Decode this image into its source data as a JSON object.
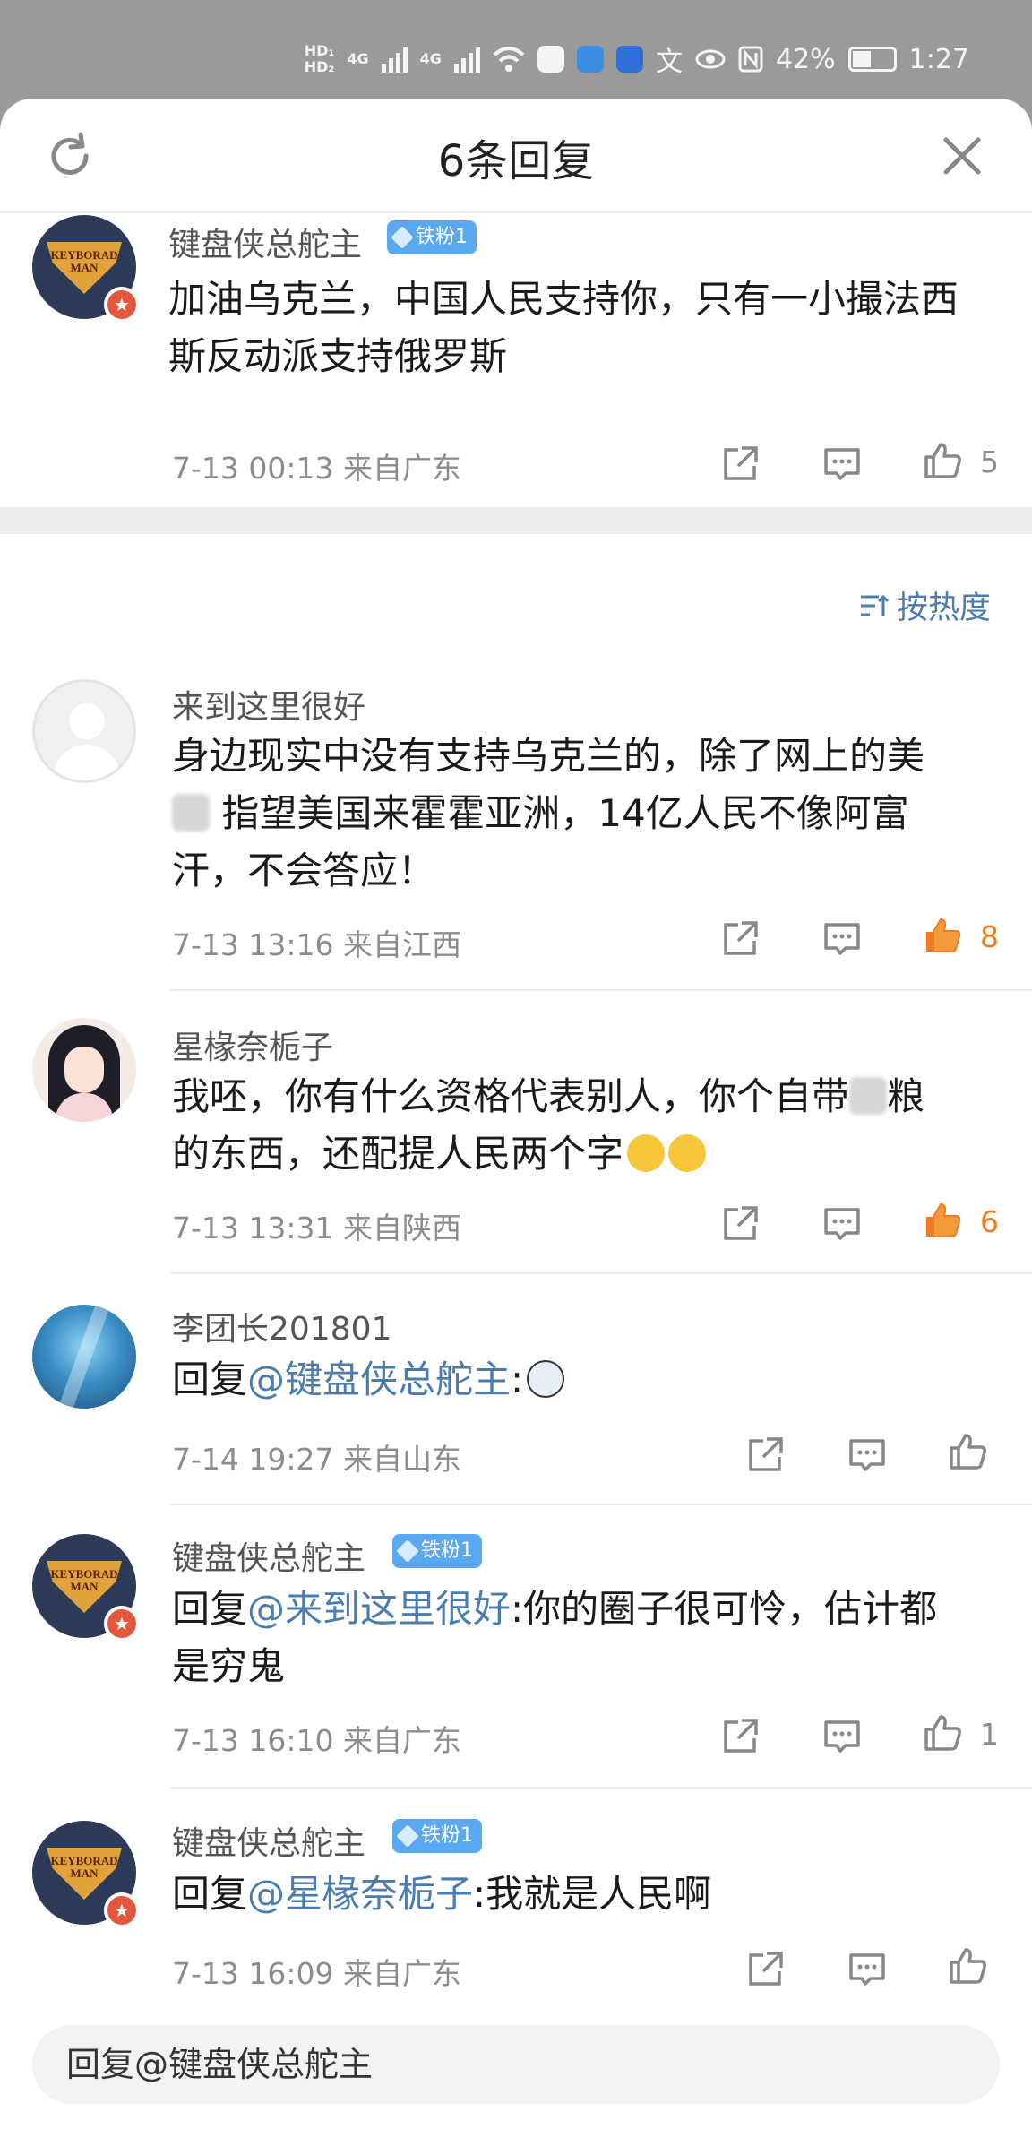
{
  "status_bar": {
    "hd1": "HD₁",
    "hd2": "HD₂",
    "net1": "4G",
    "net2": "4G",
    "battery": "42%",
    "time": "1:27"
  },
  "header": {
    "title": "6条回复"
  },
  "main_comment": {
    "user": "键盘侠总舵主",
    "badge": "铁粉1",
    "text": "加油乌克兰，中国人民支持你，只有一小撮法西斯反动派支持俄罗斯",
    "meta": "7-13 00:13 来自广东",
    "likes": "5"
  },
  "sort": {
    "label": "按热度"
  },
  "replies": [
    {
      "user": "来到这里很好",
      "text_line1": "身边现实中没有支持乌克兰的，除了网上的美",
      "text_line2": " 指望美国来霍霍亚洲，14亿人民不像阿富",
      "text_line3": "汗，不会答应！",
      "meta": "7-13 13:16 来自江西",
      "likes": "8"
    },
    {
      "user": "星椽奈栀子",
      "text_line1a": "我呸，你有什么资格代表别人，你个自带",
      "text_line1b": "粮",
      "text_line2": "的东西，还配提人民两个字",
      "meta": "7-13 13:31 来自陕西",
      "likes": "6"
    },
    {
      "user": "李团长201801",
      "prefix": "回复",
      "mention": "@键盘侠总舵主",
      "rest": ":",
      "meta": "7-14 19:27 来自山东"
    },
    {
      "user": "键盘侠总舵主",
      "badge": "铁粉1",
      "prefix": "回复",
      "mention": "@来到这里很好",
      "rest": ":你的圈子很可怜，估计都",
      "rest_line2": "是穷鬼",
      "meta": "7-13 16:10 来自广东",
      "likes": "1"
    },
    {
      "user": "键盘侠总舵主",
      "badge": "铁粉1",
      "prefix": "回复",
      "mention": "@星椽奈栀子",
      "rest": ":我就是人民啊",
      "meta": "7-13 16:09 来自广东"
    }
  ],
  "avatar_text": {
    "line1": "KEYBORAD",
    "line2": "MAN"
  },
  "reply_bar": {
    "text": "回复@键盘侠总舵主"
  },
  "colors": {
    "link": "#4a7cb0",
    "like_active": "#ef7c23",
    "badge": "#5aa8ef"
  },
  "icons": [
    "refresh-icon",
    "close-icon",
    "share-icon",
    "comment-icon",
    "like-icon",
    "sort-icon"
  ]
}
